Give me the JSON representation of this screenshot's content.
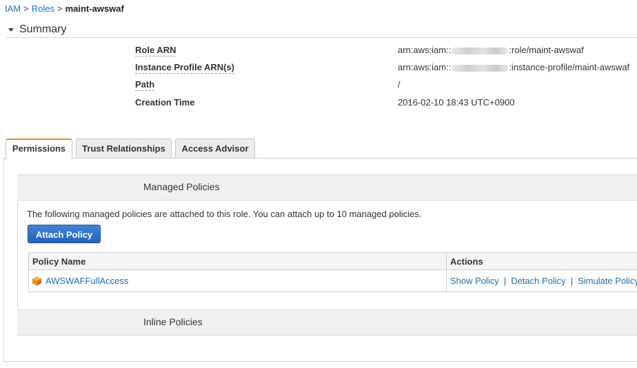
{
  "breadcrumb": {
    "iam": "IAM",
    "sep1": ">",
    "roles": "Roles",
    "sep2": ">",
    "current": "maint-awswaf"
  },
  "summary": {
    "title": "Summary",
    "rows": [
      {
        "label": "Role ARN",
        "value_prefix": "arn:aws:iam::",
        "value_suffix": ":role/maint-awswaf"
      },
      {
        "label": "Instance Profile ARN(s)",
        "value_prefix": "arn:aws:iam::",
        "value_suffix": ":instance-profile/maint-awswaf"
      },
      {
        "label": "Path",
        "value": "/"
      },
      {
        "label": "Creation Time",
        "value": "2016-02-10 18:43 UTC+0900"
      }
    ]
  },
  "tabs": [
    {
      "label": "Permissions",
      "active": true
    },
    {
      "label": "Trust Relationships",
      "active": false
    },
    {
      "label": "Access Advisor",
      "active": false
    }
  ],
  "managed": {
    "title": "Managed Policies",
    "intro": "The following managed policies are attached to this role. You can attach up to 10 managed policies.",
    "attach_button": "Attach Policy",
    "columns": {
      "name": "Policy Name",
      "actions": "Actions"
    },
    "rows": [
      {
        "name": "AWSWAFFullAccess",
        "icon": "policy-cube-icon",
        "actions": [
          "Show Policy",
          "Detach Policy",
          "Simulate Policy"
        ]
      }
    ]
  },
  "inline": {
    "title": "Inline Policies"
  },
  "colors": {
    "link": "#1a6fb5",
    "active_tab_border": "#e38c22",
    "button": "#2d6ec7",
    "policy_icon": "#f0a02e"
  }
}
